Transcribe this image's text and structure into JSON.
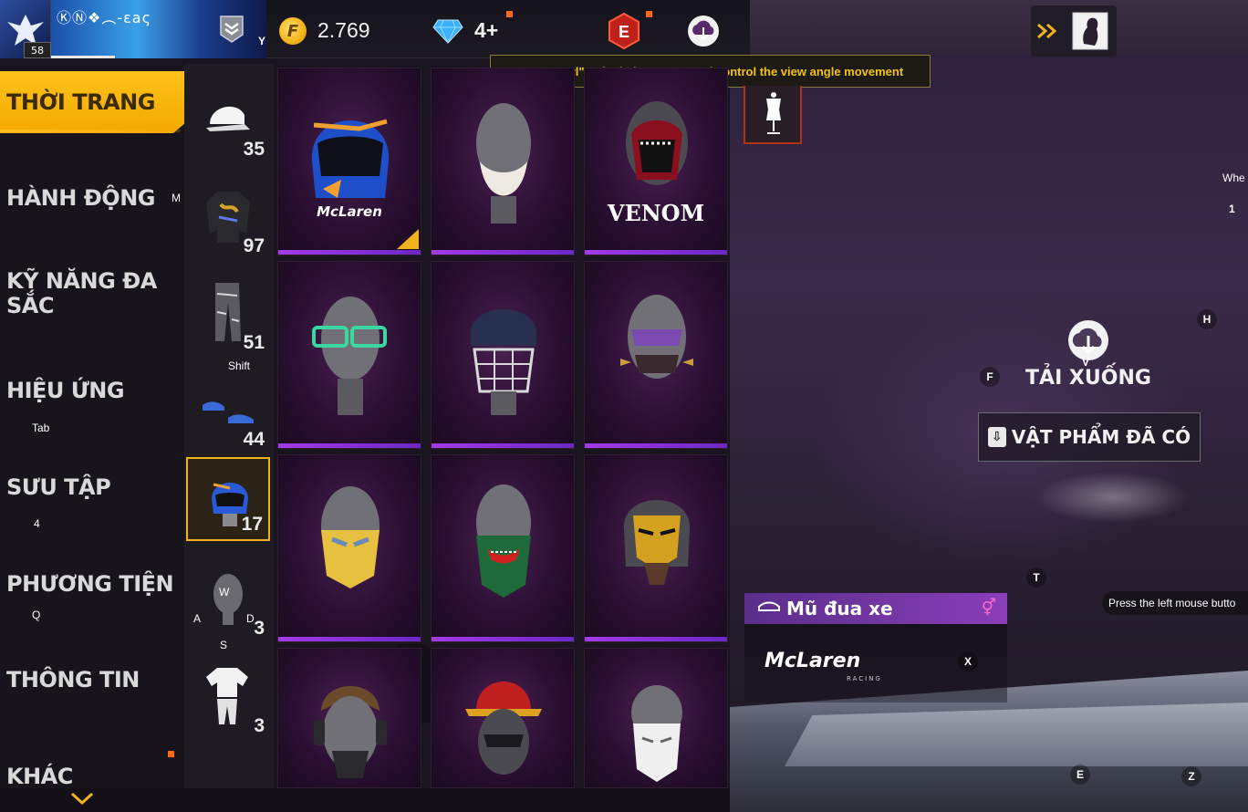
{
  "player": {
    "name": "ⓀⓃ❖︵-ɛaς",
    "level": "58"
  },
  "currency": {
    "coin_value": "2.769",
    "coin_symbol": "F",
    "diamond_value": "4+"
  },
  "elite_letter": "E",
  "tooltip": "Press \"Ctrl\" to lock the mouse and control the view angle movement",
  "categories": [
    {
      "label": "THỜI TRANG",
      "key": "Y"
    },
    {
      "label": "HÀNH ĐỘNG",
      "key": "M"
    },
    {
      "label": "KỸ NĂNG ĐA SẮC",
      "key": ""
    },
    {
      "label": "HIỆU ỨNG",
      "key": "Tab"
    },
    {
      "label": "SƯU TẬP",
      "key": "4"
    },
    {
      "label": "PHƯƠNG TIỆN",
      "key": "Q"
    },
    {
      "label": "THÔNG TIN",
      "key": ""
    },
    {
      "label": "KHÁC",
      "key": ""
    }
  ],
  "subcategories": [
    {
      "icon": "cap-icon",
      "count": "35"
    },
    {
      "icon": "jacket-icon",
      "count": "97"
    },
    {
      "icon": "pants-icon",
      "count": "51",
      "key": "Shift"
    },
    {
      "icon": "shoes-icon",
      "count": "44"
    },
    {
      "icon": "helmet-icon",
      "count": "17"
    },
    {
      "icon": "mask-icon",
      "count": "3"
    },
    {
      "icon": "outfit-icon",
      "count": "3"
    }
  ],
  "joystick_keys": {
    "up": "W",
    "left": "A",
    "right": "D",
    "down": "S"
  },
  "items": [
    {
      "name": "mclaren-helmet",
      "brand": "McLaren"
    },
    {
      "name": "beard-mask",
      "brand": ""
    },
    {
      "name": "venom-mask",
      "brand": "VENOM"
    },
    {
      "name": "green-glasses",
      "brand": ""
    },
    {
      "name": "cricket-helmet",
      "brand": ""
    },
    {
      "name": "spiked-mask",
      "brand": ""
    },
    {
      "name": "gold-face-mask",
      "brand": ""
    },
    {
      "name": "joker-bandana",
      "brand": ""
    },
    {
      "name": "gold-tiger-mask",
      "brand": ""
    },
    {
      "name": "headphone-gasmask",
      "brand": ""
    },
    {
      "name": "hat-mask",
      "brand": ""
    },
    {
      "name": "white-face-mask",
      "brand": ""
    }
  ],
  "download": {
    "label": "TẢI XUỐNG",
    "key": "V"
  },
  "owned_button": "VẬT PHẨM ĐÃ CÓ",
  "selected_item": {
    "title": "Mũ đua xe",
    "brand": "McLaren",
    "brand_sub": "RACING"
  },
  "scene_keys": {
    "wheel": "Whe",
    "one": "1",
    "h": "H",
    "f": "F",
    "t": "T",
    "x": "X",
    "e": "E",
    "z": "Z"
  },
  "left_click_hint": "Press the left mouse butto",
  "colors": {
    "accent_yellow": "#f2b21a",
    "purple_bar": "#a43ae8",
    "tooltip_text": "#f3c316"
  }
}
